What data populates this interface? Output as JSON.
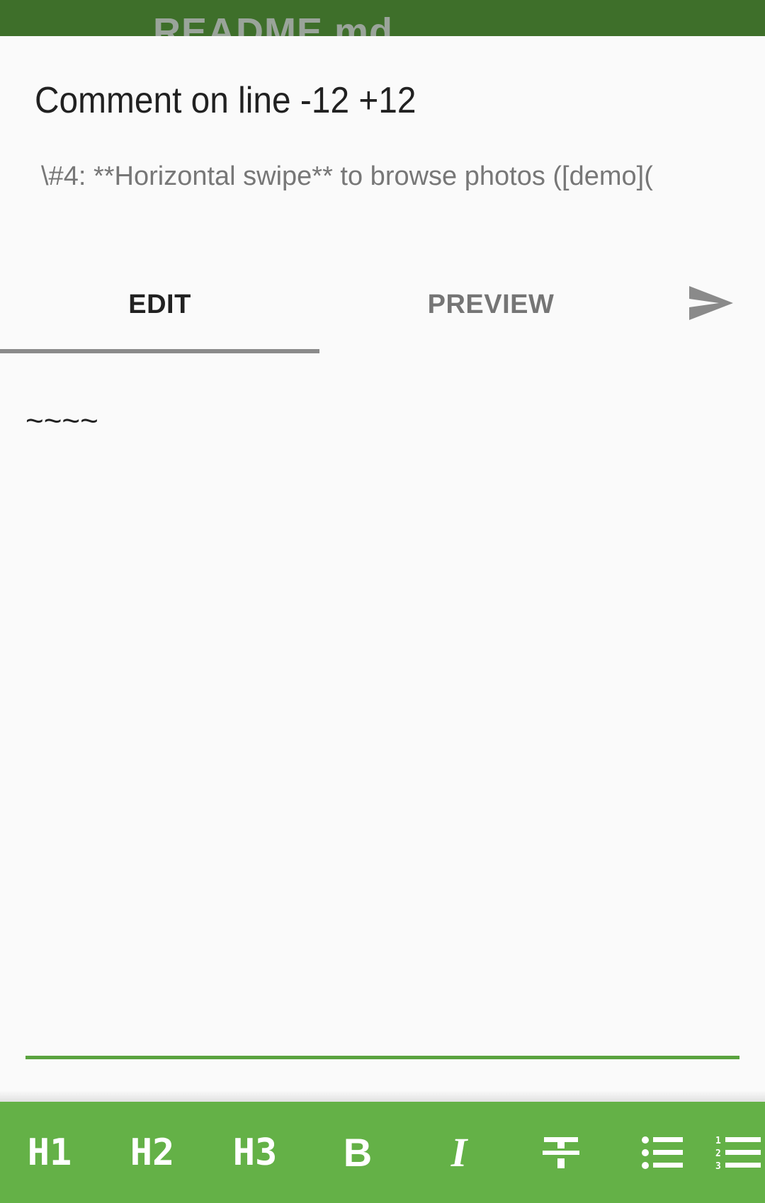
{
  "app_bar": {
    "title": "README.md"
  },
  "dialog": {
    "title": "Comment on line -12 +12",
    "line_preview": "\\#4: **Horizontal swipe** to browse photos ([demo]("
  },
  "tabs": [
    {
      "label": "EDIT",
      "selected": true
    },
    {
      "label": "PREVIEW",
      "selected": false
    }
  ],
  "send_icon": "send-icon",
  "editor": {
    "value": "~~~~"
  },
  "toolbar": {
    "items": [
      {
        "label": "H1",
        "icon": "heading-1-icon"
      },
      {
        "label": "H2",
        "icon": "heading-2-icon"
      },
      {
        "label": "H3",
        "icon": "heading-3-icon"
      },
      {
        "label": "B",
        "icon": "bold-icon"
      },
      {
        "label": "I",
        "icon": "italic-icon"
      },
      {
        "label": "",
        "icon": "strikethrough-icon"
      },
      {
        "label": "",
        "icon": "bulleted-list-icon"
      },
      {
        "label": "",
        "icon": "numbered-list-icon"
      }
    ]
  },
  "colors": {
    "app_bar": "#3e6f2a",
    "accent": "#64b147",
    "editor_underline": "#5aa33f",
    "background": "#fafafa"
  }
}
